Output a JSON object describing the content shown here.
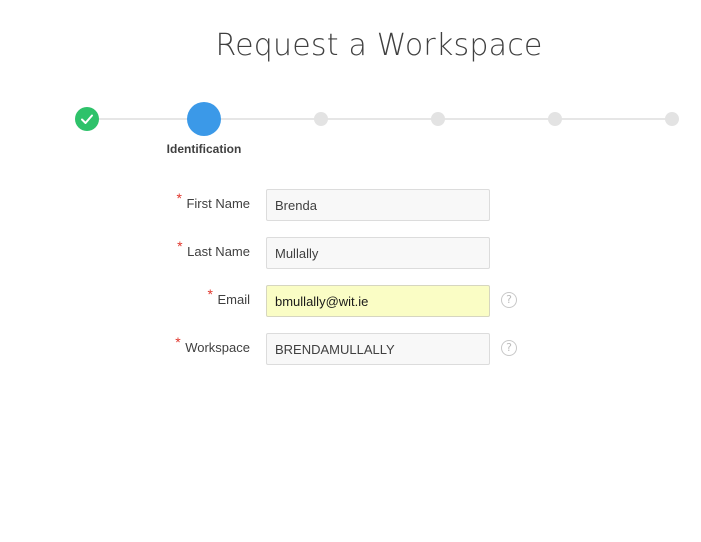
{
  "page": {
    "title": "Request a Workspace"
  },
  "wizard": {
    "active_step_label": "Identification",
    "steps": [
      {
        "status": "complete"
      },
      {
        "status": "active",
        "label": "Identification"
      },
      {
        "status": "pending"
      },
      {
        "status": "pending"
      },
      {
        "status": "pending"
      },
      {
        "status": "pending"
      }
    ],
    "colors": {
      "complete": "#2ec26a",
      "active": "#3b99e8",
      "pending": "#e3e3e3"
    }
  },
  "form": {
    "required_marker": "*",
    "first_name": {
      "label": "First Name",
      "value": "Brenda",
      "required": true
    },
    "last_name": {
      "label": "Last Name",
      "value": "Mullally",
      "required": true
    },
    "email": {
      "label": "Email",
      "value": "bmullally@wit.ie",
      "required": true,
      "help_icon": "question-circle-icon",
      "help_glyph": "?"
    },
    "workspace": {
      "label": "Workspace",
      "value": "BRENDAMULLALLY",
      "required": true,
      "help_icon": "question-circle-icon",
      "help_glyph": "?"
    }
  }
}
